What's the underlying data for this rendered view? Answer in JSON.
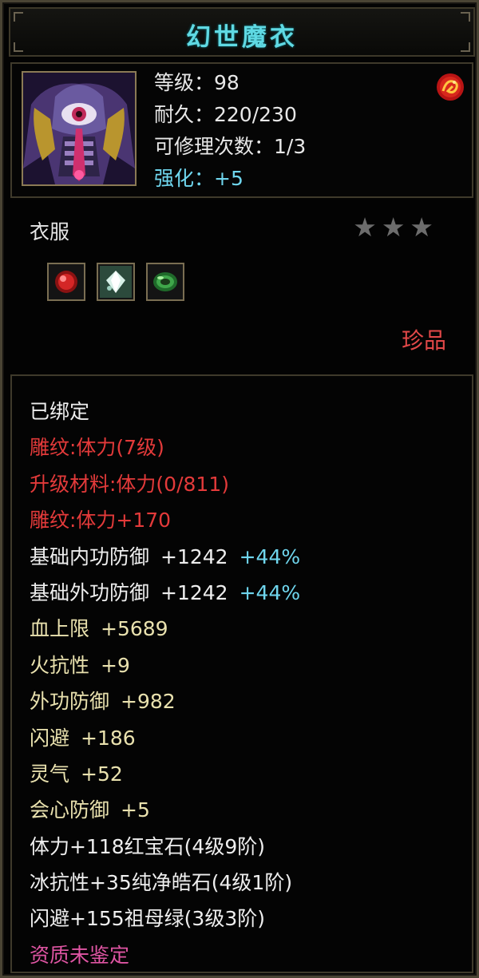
{
  "window": {
    "title": "幻世魔衣"
  },
  "header": {
    "portrait_icon": "armor-portrait-icon",
    "stats": [
      {
        "label": "等级：98",
        "color": "white"
      },
      {
        "label": "耐久：220/230",
        "color": "white"
      },
      {
        "label": "可修理次数：1/3",
        "color": "white"
      },
      {
        "label": "强化：+5",
        "color": "cyan"
      }
    ],
    "badge_icon": "dragon-emblem-icon"
  },
  "item": {
    "type": "衣服",
    "stars": "★★★",
    "star_count": 3,
    "rarity": "珍品",
    "gems": [
      {
        "icon": "ruby-gem-icon",
        "color": "#d42626"
      },
      {
        "icon": "diamond-gem-icon",
        "color": "#d8f0e8"
      },
      {
        "icon": "emerald-gem-icon",
        "color": "#3fa64a"
      }
    ]
  },
  "attributes": {
    "bound": "已绑定",
    "engrave_level": "雕纹:体力(7级)",
    "upgrade_material": "升级材料:体力(0/811)",
    "engrave_bonus": "雕纹:体力+170",
    "inner_def": {
      "label": "基础内功防御",
      "value": "+1242",
      "pct": "+44%"
    },
    "outer_def": {
      "label": "基础外功防御",
      "value": "+1242",
      "pct": "+44%"
    },
    "hp_max": {
      "label": "血上限",
      "value": "+5689"
    },
    "fire_res": {
      "label": "火抗性",
      "value": "+9"
    },
    "outer_defense": {
      "label": "外功防御",
      "value": "+982"
    },
    "dodge": {
      "label": "闪避",
      "value": "+186"
    },
    "spirit": {
      "label": "灵气",
      "value": "+52"
    },
    "crit_def": {
      "label": "会心防御",
      "value": "+5"
    },
    "gem_line_1": "体力+118红宝石(4级9阶)",
    "gem_line_2": "冰抗性+35纯净皓石(4级1阶)",
    "gem_line_3": "闪避+155祖母绿(3级3阶)",
    "quality": "资质未鉴定"
  },
  "colors": {
    "title": "#5fd9e3",
    "white": "#eeeeee",
    "red": "#e33a3a",
    "yellow": "#e9e1ae",
    "cyan": "#6fd6ee",
    "pink": "#df55a3"
  }
}
